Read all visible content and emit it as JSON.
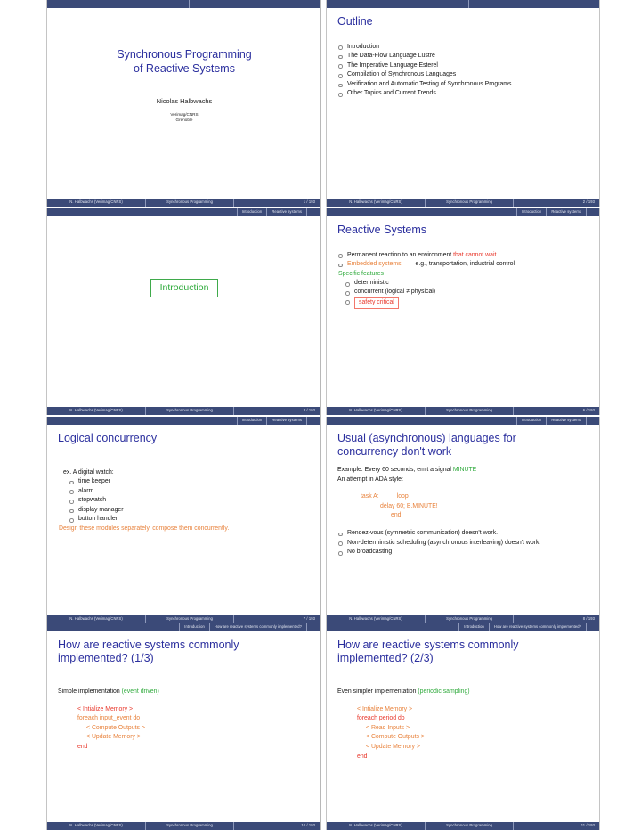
{
  "document": {
    "author_footer": "N. Halbwachs  (Verimag/CNRS)",
    "course_footer": "Synchronous Programming",
    "nav_intro": "Introduction",
    "nav_reactive": "Reactive systems",
    "nav_howimpl": "How are reactive systems commonly implemented?"
  },
  "slides": [
    {
      "id": "title-slide",
      "page": "1 / 193",
      "title_line1": "Synchronous Programming",
      "title_line2": "of Reactive Systems",
      "author": "Nicolas Halbwachs",
      "affiliation_line1": "Verimag/CNRS",
      "affiliation_line2": "Grenoble"
    },
    {
      "id": "outline-slide",
      "page": "2 / 193",
      "title": "Outline",
      "items": [
        "Introduction",
        "The Data-Flow Language Lustre",
        "The Imperative Language Esterel",
        "Compilation of Synchronous Languages",
        "Verification and Automatic Testing of Synchronous Programs",
        "Other Topics and Current Trends"
      ]
    },
    {
      "id": "introduction-section-slide",
      "page": "3 / 193",
      "box_label": "Introduction"
    },
    {
      "id": "reactive-systems-slide",
      "page": "6 / 193",
      "title": "Reactive Systems",
      "bullet1_plain": "Permanent reaction to an environment ",
      "bullet1_red": "that cannot wait",
      "bullet2_orange": "Embedded systems",
      "bullet2_plain": "e.g., transportation, industrial control",
      "features_heading": "Specific features",
      "feature1": "deterministic",
      "feature2": "concurrent (logical ≠ physical)",
      "feature3": "safety critical"
    },
    {
      "id": "logical-concurrency-slide",
      "page": "7 / 193",
      "title": "Logical concurrency",
      "example_label": "ex.  A digital watch:",
      "items": [
        "time keeper",
        "alarm",
        "stopwatch",
        "display manager",
        "button handler"
      ],
      "conclusion": "Design these modules separately, compose them concurrently."
    },
    {
      "id": "async-languages-slide",
      "page": "8 / 193",
      "title_line1": "Usual (asynchronous) languages for",
      "title_line2": "concurrency don't work",
      "example_plain": "Example: Every 60 seconds, emit a signal ",
      "example_green": "MINUTE",
      "attempt_line": "An attempt in ADA style:",
      "code_task": "task A:",
      "code_loop": "loop",
      "code_delay": "delay 60; B.MINUTE!",
      "code_end": "end",
      "items": [
        "Rendez-vous (symmetric communication) doesn't work.",
        "Non-deterministic scheduling (asynchronous interleaving) doesn't work.",
        "No broadcasting"
      ]
    },
    {
      "id": "how-implemented-1-slide",
      "page": "10 / 193",
      "title_line1": "How are reactive systems commonly",
      "title_line2": "implemented? (1/3)",
      "lead_plain": "Simple implementation ",
      "lead_green": "(event driven)",
      "code": [
        "< Intialize Memory >",
        "foreach input_event do",
        "< Compute Outputs >",
        "< Update Memory >",
        "end"
      ]
    },
    {
      "id": "how-implemented-2-slide",
      "page": "11 / 193",
      "title_line1": "How are reactive systems commonly",
      "title_line2": "implemented? (2/3)",
      "lead_plain": "Even simpler implementation ",
      "lead_green": "(periodic sampling)",
      "code": [
        "< Intialize Memory >",
        "foreach period do",
        "< Read Inputs >",
        "< Compute Outputs >",
        "< Update Memory >",
        "end"
      ]
    }
  ],
  "colors": {
    "navbar": "#3b4a78",
    "title_blue": "#2b2f9e",
    "accent_red": "#e8372b",
    "accent_orange": "#e8823c",
    "accent_green": "#2faa3c"
  }
}
